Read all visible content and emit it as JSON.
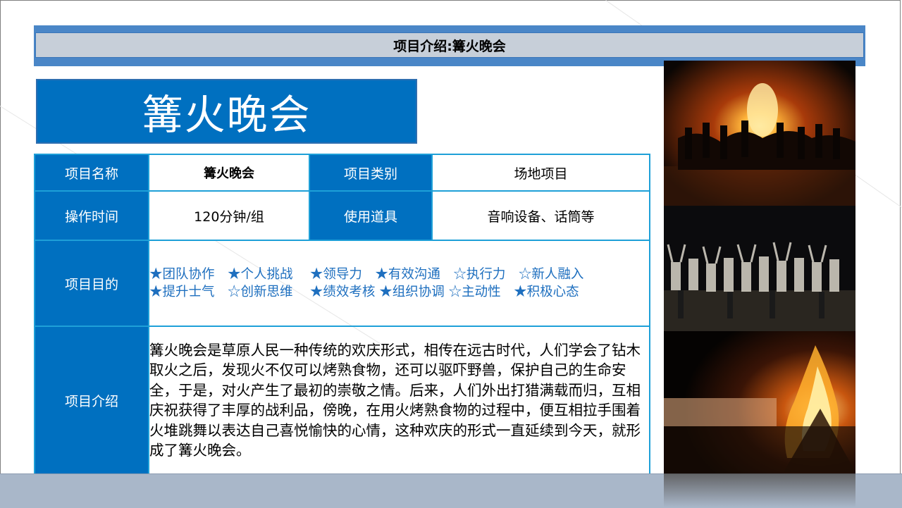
{
  "header": {
    "title": "项目介绍:篝火晚会"
  },
  "banner": {
    "title": "篝火晚会"
  },
  "table": {
    "name_label": "项目名称",
    "name_value": "篝火晚会",
    "category_label": "项目类别",
    "category_value": "场地项目",
    "time_label": "操作时间",
    "time_value_num": "120",
    "time_value_unit": "分钟/组",
    "props_label": "使用道具",
    "props_value": "音响设备、话筒等",
    "goals_label": "项目目的",
    "goals_line1": "★团队协作　★个人挑战　 ★领导力　★有效沟通　☆执行力　☆新人融入",
    "goals_line2": "★提升士气　☆创新思维　 ★绩效考核 ★组织协调 ☆主动性　★积极心态",
    "intro_label": "项目介绍",
    "intro_text": "篝火晚会是草原人民一种传统的欢庆形式，相传在远古时代，人们学会了钻木取火之后，发现火不仅可以烤熟食物，还可以驱吓野兽，保护自己的生命安全，于是，对火产生了最初的崇敬之情。后来，人们外出打猎满载而归，互相庆祝获得了丰厚的战利品，傍晚，在用火烤熟食物的过程中，便互相拉手围着火堆跳舞以表达自己喜悦愉快的心情，这种欢庆的形式一直延续到今天，就形成了篝火晚会。"
  },
  "colors": {
    "accent_blue": "#0070c0",
    "table_border": "#1ea0d8",
    "goal_text": "#1e6fbf",
    "header_bar": "#c7cfd9",
    "bottom_bar": "#a9b7c9"
  },
  "photos": [
    {
      "name": "photo-campfire-dance-circle"
    },
    {
      "name": "photo-crowd-arms-raised"
    },
    {
      "name": "photo-bonfire-crowd"
    }
  ]
}
